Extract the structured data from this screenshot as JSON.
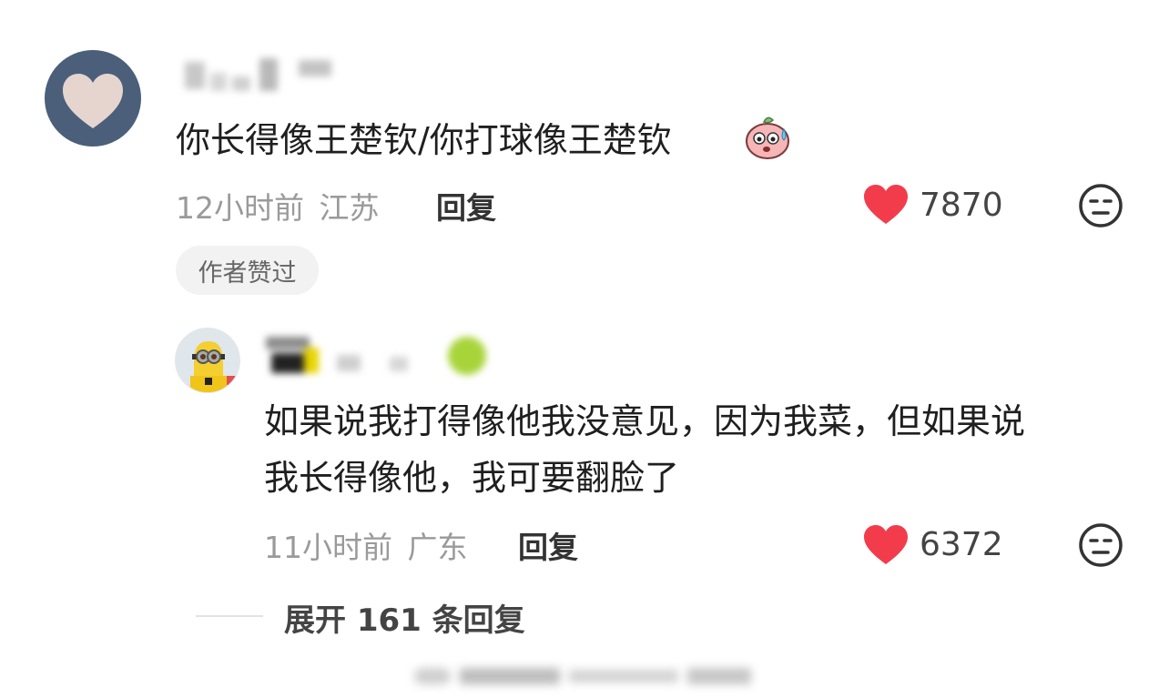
{
  "comments": [
    {
      "text": "你长得像王楚钦/你打球像王楚钦",
      "emoji_icon": "sweating-face-icon",
      "time": "12小时前",
      "location": "江苏",
      "reply_label": "回复",
      "like_count": "7870",
      "badge": "作者赞过"
    },
    {
      "text_line1": "如果说我打得像他我没意见，因为我菜，但如果说",
      "text_line2": "我长得像他，我可要翻脸了",
      "time": "11小时前",
      "location": "广东",
      "reply_label": "回复",
      "like_count": "6372"
    }
  ],
  "expand_label": "展开 161 条回复",
  "colors": {
    "heart": "#f23c4c",
    "avatar_bg": "#4b5f7a",
    "heart_avatar": "#e6d5cf"
  },
  "icons": [
    "heart-icon",
    "meh-face-icon",
    "sweating-face-icon"
  ]
}
